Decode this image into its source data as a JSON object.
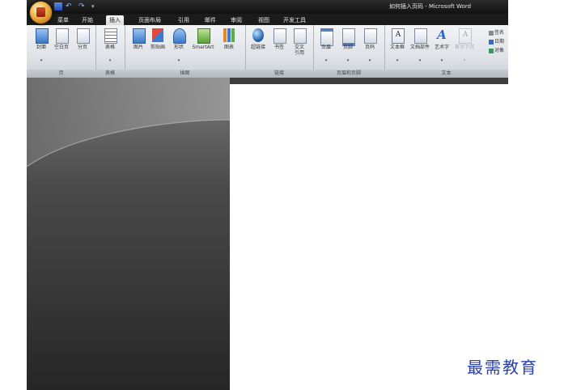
{
  "window": {
    "title": "如何插入页码 - Microsoft Word"
  },
  "tabs": [
    "菜单",
    "开始",
    "插入",
    "页面布局",
    "引用",
    "邮件",
    "审阅",
    "视图",
    "开发工具"
  ],
  "active_tab": "插入",
  "ribbon": {
    "groups": {
      "pages": "页",
      "tables": "表格",
      "illustrations": "插图",
      "links": "链接",
      "header_footer": "页眉和页脚",
      "text": "文本"
    },
    "commands": {
      "cover_page": "封面",
      "blank_page": "空白页",
      "page_break": "分页",
      "table": "表格",
      "picture": "图片",
      "clip_art": "剪贴画",
      "shapes": "形状",
      "smartart": "SmartArt",
      "chart": "图表",
      "hyperlink": "超链接",
      "bookmark": "书签",
      "cross_ref_line1": "交叉",
      "cross_ref_line2": "引用",
      "header": "页眉",
      "footer": "页脚",
      "page_number": "页码",
      "text_box": "文本框",
      "quick_parts": "文档部件",
      "wordart": "艺术字",
      "drop_cap": "首字下沉",
      "signature_line": "签名",
      "date_time": "日期",
      "object": "对象"
    }
  },
  "watermark": {
    "text": "最需教育"
  },
  "colors": {
    "titlebar": "#111111",
    "ribbon": "#dfe2e7",
    "workspace": "#3d3d3d",
    "watermark": "#2a3ea8"
  }
}
